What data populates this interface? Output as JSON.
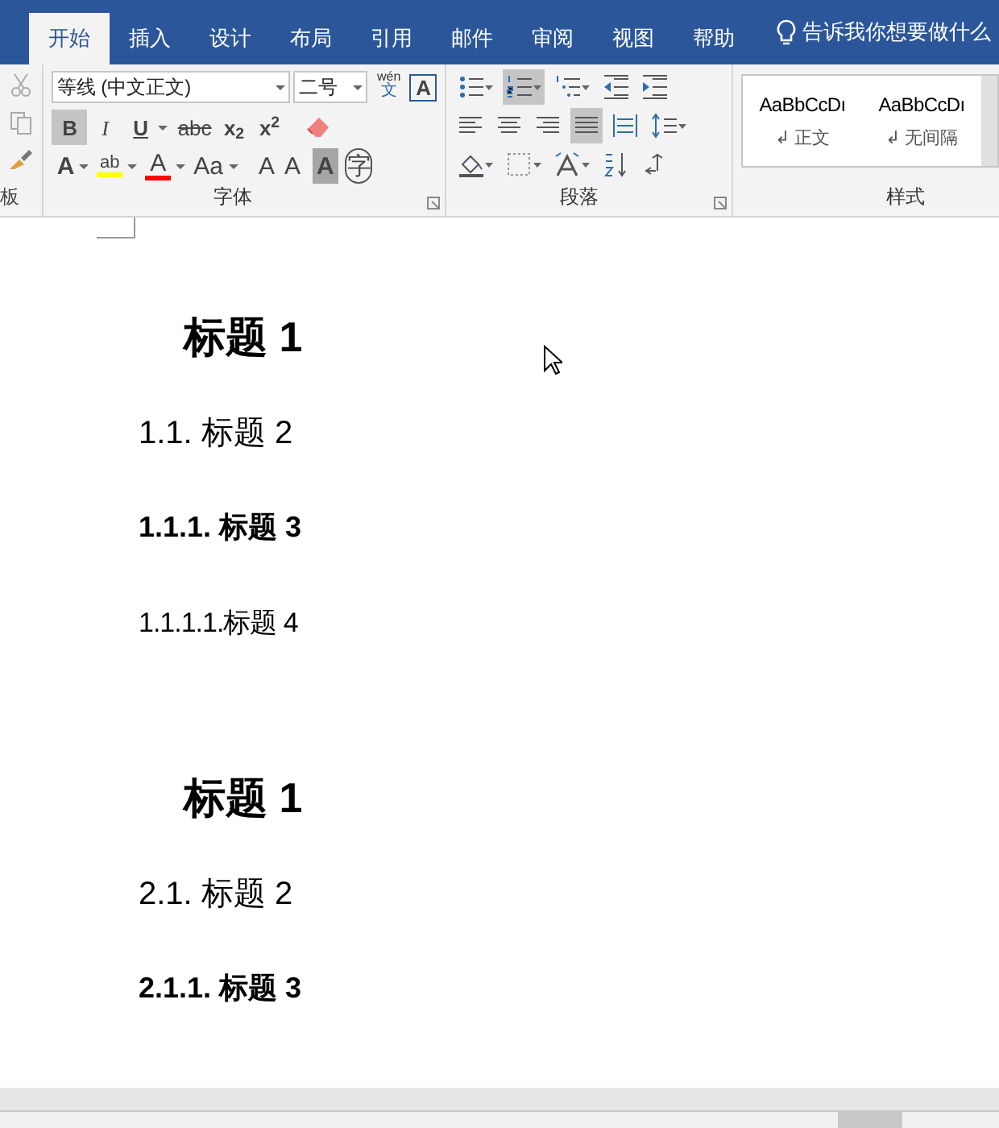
{
  "tabs": [
    {
      "label": "开始",
      "selected": true
    },
    {
      "label": "插入",
      "selected": false
    },
    {
      "label": "设计",
      "selected": false
    },
    {
      "label": "布局",
      "selected": false
    },
    {
      "label": "引用",
      "selected": false
    },
    {
      "label": "邮件",
      "selected": false
    },
    {
      "label": "审阅",
      "selected": false
    },
    {
      "label": "视图",
      "selected": false
    },
    {
      "label": "帮助",
      "selected": false
    }
  ],
  "tell_me": "告诉我你想要做什么",
  "clipboard": {
    "label": "板"
  },
  "font": {
    "name": "等线 (中文正文)",
    "size": "二号",
    "phonetic": "wén",
    "phonetic_base": "文",
    "border_char": "A",
    "label": "字体",
    "format_buttons": [
      {
        "kind": "bold",
        "text": "B",
        "selected": true
      },
      {
        "kind": "italic",
        "text": "I",
        "selected": false
      },
      {
        "kind": "underline",
        "text": "U",
        "selected": false
      },
      {
        "kind": "strike",
        "text": "abc",
        "selected": false
      },
      {
        "kind": "sub",
        "text": "x$_{2}$",
        "selected": false
      },
      {
        "kind": "sup",
        "text": "x$^{2}$",
        "selected": false
      }
    ],
    "row3": [
      {
        "kind": "effect",
        "text": "A"
      },
      {
        "kind": "highlight",
        "text": "ab",
        "color": "#ffff00"
      },
      {
        "kind": "fontcolor",
        "text": "A",
        "color": "#ff0000"
      },
      {
        "kind": "case",
        "text": "Aa"
      },
      {
        "kind": "grow",
        "text": "A"
      },
      {
        "kind": "shrink",
        "text": "A"
      },
      {
        "kind": "shade",
        "text": "A"
      },
      {
        "kind": "enclose",
        "text": "字"
      }
    ]
  },
  "paragraph": {
    "label": "段落",
    "rows": [
      [
        {
          "kind": "bullets",
          "selected": false
        },
        {
          "kind": "numbering",
          "selected": true
        },
        {
          "kind": "multilevel",
          "selected": false
        },
        {
          "kind": "outdent",
          "selected": false
        },
        {
          "kind": "indent",
          "selected": false
        }
      ],
      [
        {
          "kind": "left",
          "selected": false
        },
        {
          "kind": "center",
          "selected": false
        },
        {
          "kind": "right",
          "selected": false
        },
        {
          "kind": "justify",
          "selected": true
        },
        {
          "kind": "distribute",
          "selected": false
        },
        {
          "kind": "spacing",
          "selected": false
        }
      ],
      [
        {
          "kind": "shading",
          "selected": false
        },
        {
          "kind": "borders",
          "selected": false
        },
        {
          "kind": "chinese",
          "selected": false
        },
        {
          "kind": "sort",
          "selected": false
        },
        {
          "kind": "marks",
          "selected": false
        }
      ]
    ]
  },
  "styles": {
    "label": "样式",
    "items": [
      {
        "preview": "AaBbCcDı",
        "name": "↲ 正文"
      },
      {
        "preview": "AaBbCcDı",
        "name": "↲ 无间隔"
      }
    ]
  },
  "document": {
    "paragraphs": [
      {
        "kind": "h1",
        "text": "标题 1"
      },
      {
        "kind": "h2",
        "text": "1.1. 标题 2"
      },
      {
        "kind": "h3",
        "text": "1.1.1. 标题 3"
      },
      {
        "kind": "h4",
        "text": "1.1.1.1.标题 4"
      },
      {
        "kind": "gap"
      },
      {
        "kind": "h1",
        "text": "标题 1"
      },
      {
        "kind": "h2",
        "text": "2.1. 标题 2"
      },
      {
        "kind": "h3",
        "text": "2.1.1. 标题 3"
      }
    ]
  }
}
